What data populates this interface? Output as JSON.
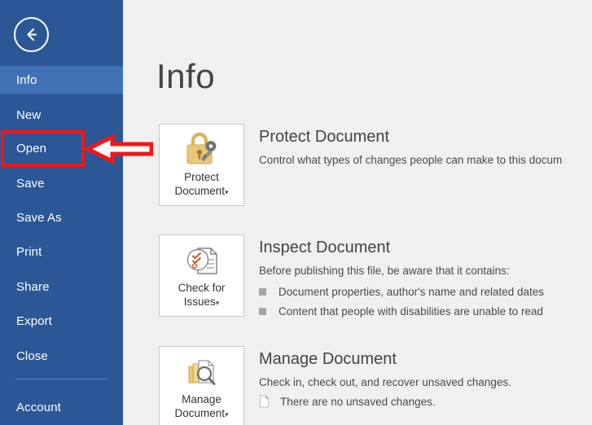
{
  "app": {
    "back_button": "back-arrow-icon",
    "accent_blue": "#2b5797",
    "active_blue": "#4071b5",
    "annotation_red": "#f41616",
    "background": "#f0f0f0"
  },
  "sidebar": {
    "items": [
      {
        "label": "Info",
        "active": true
      },
      {
        "label": "New",
        "active": false
      },
      {
        "label": "Open",
        "active": false
      },
      {
        "label": "Save",
        "active": false
      },
      {
        "label": "Save As",
        "active": false
      },
      {
        "label": "Print",
        "active": false
      },
      {
        "label": "Share",
        "active": false
      },
      {
        "label": "Export",
        "active": false
      },
      {
        "label": "Close",
        "active": false
      },
      {
        "label": "Account",
        "active": false
      }
    ]
  },
  "main": {
    "page_title": "Info",
    "sections": [
      {
        "card_label_line1": "Protect",
        "card_label_line2": "Document",
        "card_icon": "lock-and-key-icon",
        "title": "Protect Document",
        "subtitle": "Control what types of changes people can make to this docum",
        "bullets": []
      },
      {
        "card_label_line1": "Check for",
        "card_label_line2": "Issues",
        "card_icon": "document-check-icon",
        "title": "Inspect Document",
        "subtitle": "Before publishing this file, be aware that it contains:",
        "bullets": [
          {
            "icon": "square-bullet",
            "text": "Document properties, author's name and related dates"
          },
          {
            "icon": "square-bullet",
            "text": "Content that people with disabilities are unable to read"
          }
        ]
      },
      {
        "card_label_line1": "Manage",
        "card_label_line2": "Document",
        "card_icon": "document-stack-search-icon",
        "title": "Manage Document",
        "subtitle": "Check in, check out, and recover unsaved changes.",
        "bullets": [
          {
            "icon": "document-page-icon",
            "text": "There are no unsaved changes."
          }
        ]
      }
    ],
    "dropdown_caret": "▾"
  },
  "annotation": {
    "highlight_target": "Open",
    "shape_rect": "red-rectangle",
    "shape_arrow": "red-left-arrow"
  }
}
